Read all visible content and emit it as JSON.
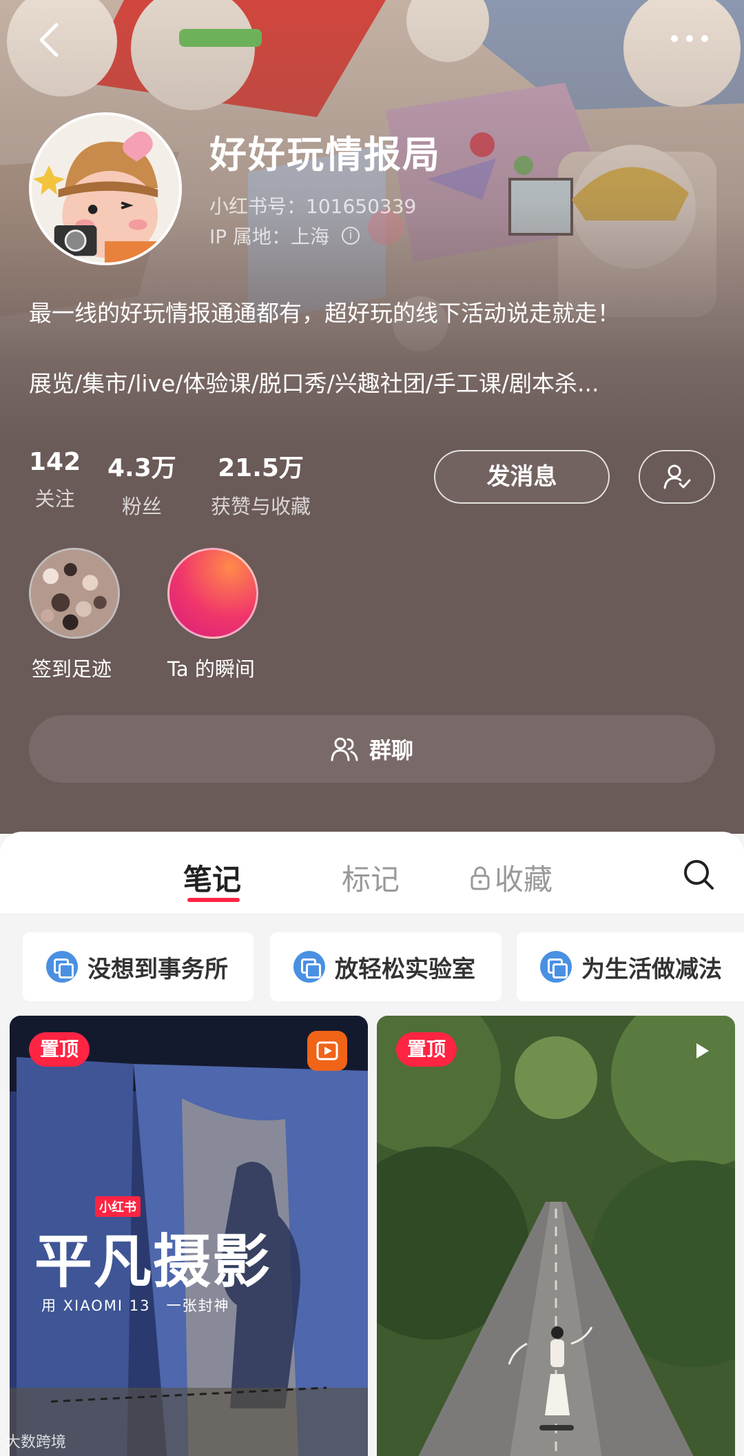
{
  "profile": {
    "nickname": "好好玩情报局",
    "redid": "小红书号：101650339",
    "ip": "IP 属地：上海",
    "info_glyph": "i",
    "bio_line1": "最一线的好玩情报通通都有，超好玩的线下活动说走就走！",
    "bio_line2": "展览/集市/live/体验课/脱口秀/兴趣社团/手工课/剧本杀..."
  },
  "stats": [
    {
      "value": "142",
      "label": "关注"
    },
    {
      "value": "4.3万",
      "label": "粉丝"
    },
    {
      "value": "21.5万",
      "label": "获赞与收藏"
    }
  ],
  "actions": {
    "message_label": "发消息",
    "follow_icon": "user-check-icon"
  },
  "highlights": [
    {
      "label": "签到足迹"
    },
    {
      "label": "Ta 的瞬间"
    }
  ],
  "group_chat": {
    "label": "群聊",
    "icon": "people-icon"
  },
  "tabs": [
    {
      "label": "笔记",
      "active": true
    },
    {
      "label": "标记",
      "active": false
    },
    {
      "label": "收藏",
      "active": false,
      "icon": "lock-icon"
    }
  ],
  "collections": [
    {
      "label": "没想到事务所"
    },
    {
      "label": "放轻松实验室"
    },
    {
      "label": "为生活做减法"
    }
  ],
  "notes": [
    {
      "pinned_label": "置顶",
      "poster_brand": "小红书",
      "poster_title": "平凡摄影",
      "poster_sub": "用 XIAOMI 13　一张封神"
    },
    {
      "pinned_label": "置顶"
    }
  ],
  "watermark": "大数跨境",
  "colors": {
    "accent": "#ff2442",
    "header_bg": "#6a5a58",
    "chip_icon": "#4a90e2"
  }
}
